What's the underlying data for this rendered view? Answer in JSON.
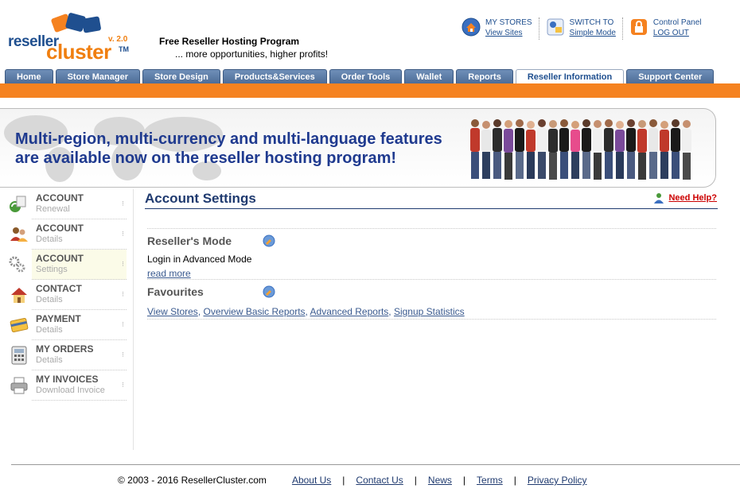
{
  "logo": {
    "word1": "reseller",
    "word2": "cluster",
    "tm": "TM",
    "version": "v. 2.0"
  },
  "tagline": {
    "line1": "Free Reseller Hosting Program",
    "line2": "... more opportunities, higher profits!"
  },
  "toplinks": [
    {
      "line1": "MY STORES",
      "line2": "View Sites",
      "icon": "home-globe-icon"
    },
    {
      "line1": "SWITCH TO",
      "line2": "Simple Mode",
      "icon": "switch-mode-icon"
    },
    {
      "line1": "Control Panel",
      "line2": "LOG OUT",
      "icon": "lock-icon"
    }
  ],
  "tabs": [
    "Home",
    "Store Manager",
    "Store Design",
    "Products&Services",
    "Order Tools",
    "Wallet",
    "Reports",
    "Reseller Information",
    "Support Center"
  ],
  "active_tab": "Reseller Information",
  "banner": {
    "line1": "Multi-region, multi-currency and multi-language features",
    "line2": "are available now on the reseller hosting program!"
  },
  "sidebar": [
    {
      "title": "ACCOUNT",
      "sub": "Renewal",
      "icon": "renewal-icon"
    },
    {
      "title": "ACCOUNT",
      "sub": "Details",
      "icon": "users-icon"
    },
    {
      "title": "ACCOUNT",
      "sub": "Settings",
      "icon": "gears-icon"
    },
    {
      "title": "CONTACT",
      "sub": "Details",
      "icon": "house-icon"
    },
    {
      "title": "PAYMENT",
      "sub": "Details",
      "icon": "credit-card-icon"
    },
    {
      "title": "MY ORDERS",
      "sub": "Details",
      "icon": "calculator-icon"
    },
    {
      "title": "MY INVOICES",
      "sub": "Download Invoice",
      "icon": "printer-icon"
    }
  ],
  "active_sidebar_index": 2,
  "main": {
    "title": "Account Settings",
    "help_label": "Need Help?",
    "mode_section": {
      "title": "Reseller's Mode",
      "text": "Login in Advanced Mode",
      "read_more": "read more"
    },
    "fav_section": {
      "title": "Favourites",
      "links": [
        "View Stores",
        "Overview Basic Reports",
        "Advanced Reports",
        "Signup Statistics"
      ]
    }
  },
  "footer": {
    "copyright": "© 2003 - 2016 ResellerCluster.com",
    "links": [
      "About Us",
      "Contact Us",
      "News",
      "Terms",
      "Privacy Policy"
    ]
  },
  "colors": {
    "brand_blue": "#1f4f8f",
    "brand_orange": "#f58220",
    "tab_blue": "#5a7aa8"
  }
}
